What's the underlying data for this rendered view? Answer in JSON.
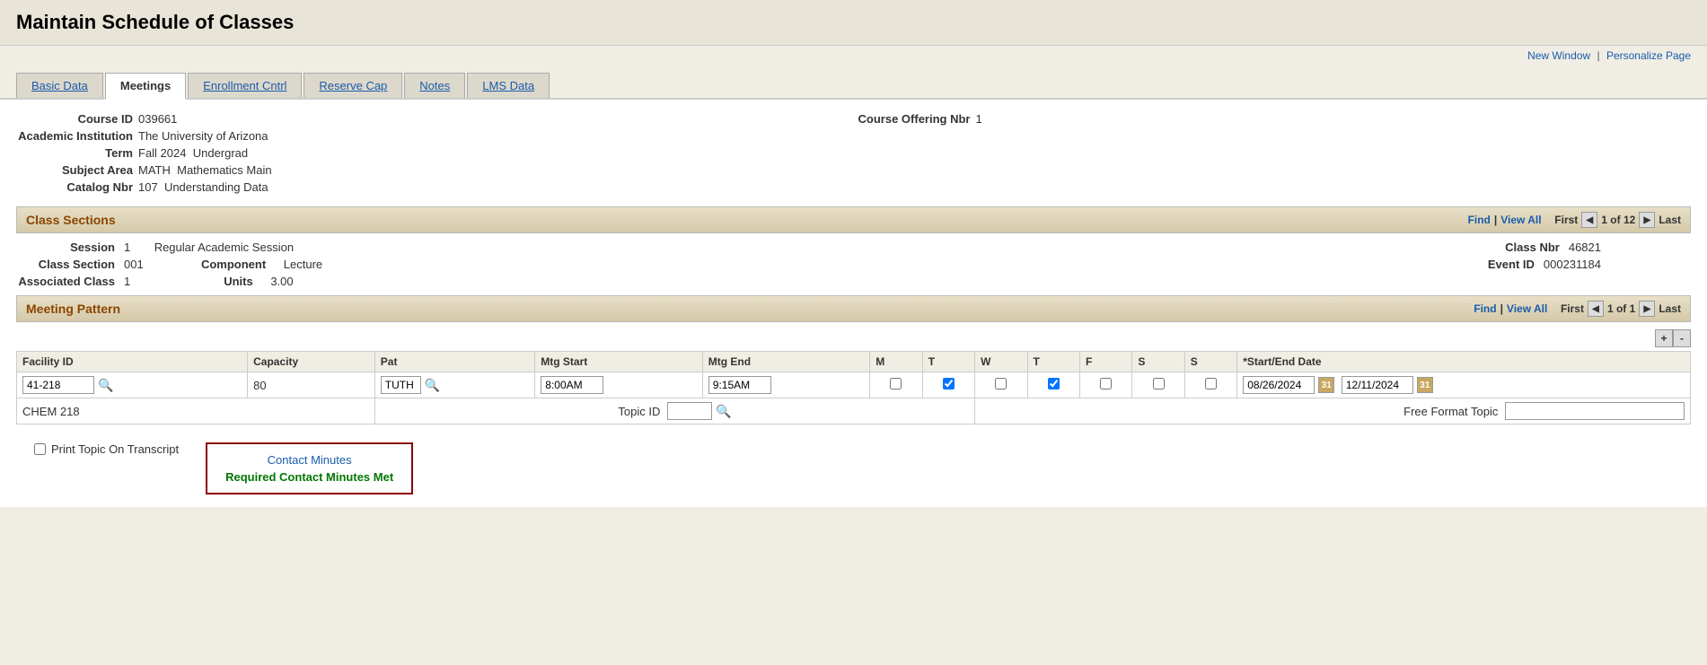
{
  "page": {
    "title": "Maintain Schedule of Classes",
    "top_links": {
      "new_window": "New Window",
      "separator": "|",
      "personalize": "Personalize Page"
    }
  },
  "tabs": [
    {
      "id": "basic-data",
      "label": "Basic Data",
      "active": false
    },
    {
      "id": "meetings",
      "label": "Meetings",
      "active": true
    },
    {
      "id": "enrollment-cntrl",
      "label": "Enrollment Cntrl",
      "active": false
    },
    {
      "id": "reserve-cap",
      "label": "Reserve Cap",
      "active": false
    },
    {
      "id": "notes",
      "label": "Notes",
      "active": false
    },
    {
      "id": "lms-data",
      "label": "LMS Data",
      "active": false
    }
  ],
  "course_info": {
    "course_id_label": "Course ID",
    "course_id_value": "039661",
    "course_offering_nbr_label": "Course Offering Nbr",
    "course_offering_nbr_value": "1",
    "academic_institution_label": "Academic Institution",
    "academic_institution_value": "The University of Arizona",
    "term_label": "Term",
    "term_value": "Fall 2024",
    "term_type": "Undergrad",
    "subject_area_label": "Subject Area",
    "subject_area_value": "MATH",
    "subject_area_desc": "Mathematics Main",
    "catalog_nbr_label": "Catalog Nbr",
    "catalog_nbr_value": "107",
    "catalog_desc": "Understanding Data"
  },
  "class_sections": {
    "section_title": "Class Sections",
    "find_link": "Find",
    "view_all_link": "View All",
    "first_label": "First",
    "last_label": "Last",
    "current_page": "1 of 12",
    "session_label": "Session",
    "session_value": "1",
    "session_desc": "Regular Academic Session",
    "class_nbr_label": "Class Nbr",
    "class_nbr_value": "46821",
    "class_section_label": "Class Section",
    "class_section_value": "001",
    "component_label": "Component",
    "component_value": "Lecture",
    "event_id_label": "Event ID",
    "event_id_value": "000231184",
    "associated_class_label": "Associated Class",
    "associated_class_value": "1",
    "units_label": "Units",
    "units_value": "3.00"
  },
  "meeting_pattern": {
    "section_title": "Meeting Pattern",
    "find_link": "Find",
    "view_all_link": "View All",
    "first_label": "First",
    "last_label": "Last",
    "current_page": "1 of 1",
    "add_btn": "+",
    "remove_btn": "-",
    "columns": {
      "facility_id": "Facility ID",
      "capacity": "Capacity",
      "pat": "Pat",
      "mtg_start": "Mtg Start",
      "mtg_end": "Mtg End",
      "m": "M",
      "t": "T",
      "w": "W",
      "th": "T",
      "f": "F",
      "s": "S",
      "su": "S",
      "start_end_date": "*Start/End Date"
    },
    "row": {
      "facility_id": "41-218",
      "capacity": "80",
      "pat": "TUTH",
      "mtg_start": "8:00AM",
      "mtg_end": "9:15AM",
      "m_checked": false,
      "t_checked": true,
      "w_checked": false,
      "th_checked": true,
      "f_checked": false,
      "s_checked": false,
      "su_checked": false,
      "start_date": "08/26/2024",
      "end_date": "12/11/2024"
    },
    "room_label": "CHEM  218",
    "topic_id_label": "Topic ID",
    "topic_id_value": "",
    "free_format_topic_label": "Free Format Topic",
    "free_format_topic_value": ""
  },
  "bottom": {
    "print_topic_label": "Print Topic On Transcript",
    "contact_minutes_title": "Contact Minutes",
    "contact_minutes_met": "Required Contact Minutes Met"
  }
}
